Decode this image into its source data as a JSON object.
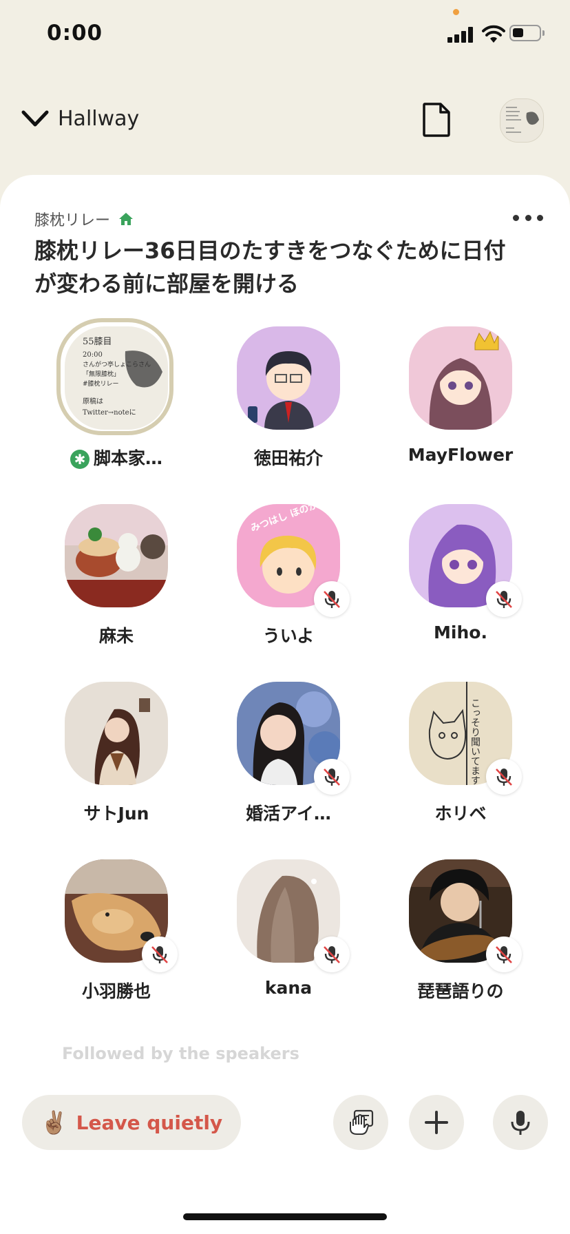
{
  "status": {
    "time": "0:00"
  },
  "topbar": {
    "back_label": "Hallway"
  },
  "room": {
    "club": "膝枕リレー",
    "title": "膝枕リレー36日目のたすきをつなぐために日付が変わる前に部屋を開ける"
  },
  "speakers": [
    {
      "name": "脚本家…",
      "moderator": true,
      "muted": false
    },
    {
      "name": "徳田祐介",
      "muted": false
    },
    {
      "name": "MayFlower",
      "muted": false
    },
    {
      "name": "麻未",
      "muted": false
    },
    {
      "name": "ういよ",
      "muted": true
    },
    {
      "name": "Miho.",
      "muted": true
    },
    {
      "name": "サトJun",
      "muted": false
    },
    {
      "name": "婚活アイ…",
      "muted": true
    },
    {
      "name": "ホリベ",
      "muted": true
    },
    {
      "name": "小羽勝也",
      "muted": true
    },
    {
      "name": "kana",
      "muted": true
    },
    {
      "name": "琵琶語りの",
      "muted": true
    }
  ],
  "avatar_texts": {
    "line1": "55膝目",
    "line2": "20:00",
    "line3": "さんがつ亭しょこらさん",
    "line4": "「無限膝枕」",
    "line5": "#膝枕リレー",
    "line6": "原稿は",
    "line7": "Twitter→noteに",
    "uiyo_badge": "みつはし ほのか",
    "horibe_note": "こっそり聞いてます"
  },
  "moderator_mark": "✱",
  "followed_label": "Followed by the speakers",
  "actions": {
    "leave_label": "Leave quietly",
    "leave_emoji": "✌🏽"
  },
  "colors": {
    "accent_leave": "#d4574a",
    "moderator": "#3aa35c",
    "background": "#f2efe4"
  }
}
